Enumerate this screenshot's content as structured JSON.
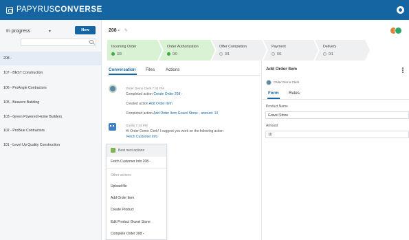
{
  "app": {
    "brand_light": "PAPYRUS",
    "brand_bold": "CONVERSE"
  },
  "sidebar": {
    "filter": "In progress",
    "new_button": "New",
    "search_placeholder": "",
    "items": [
      {
        "label": "208 -",
        "active": true
      },
      {
        "label": "107 - BEST Construction"
      },
      {
        "label": "106 - ProAngle Contractors"
      },
      {
        "label": "105 - Beavers Building"
      },
      {
        "label": "103 - Green Powered Home Builders"
      },
      {
        "label": "102 - ProBlue Contractors"
      },
      {
        "label": "101 - Level Up Quality Construction"
      }
    ]
  },
  "header": {
    "title": "208 -"
  },
  "steps": [
    {
      "label": "Incoming Order",
      "count": "3/3",
      "status": "done"
    },
    {
      "label": "Order Authorization",
      "count": "0/0",
      "status": "done"
    },
    {
      "label": "Offer Completion",
      "count": "0/1",
      "status": "todo"
    },
    {
      "label": "Payment",
      "count": "0/1",
      "status": "todo"
    },
    {
      "label": "Delivery",
      "count": "0/1",
      "status": "todo"
    }
  ],
  "tabs": [
    "Conversation",
    "Files",
    "Actions"
  ],
  "conversation": {
    "msg1": {
      "meta": "Order Demo Clerk  7:42 PM",
      "line1_prefix": "Completed action ",
      "line1_link": "Create Order 208 -",
      "line2_prefix": "Created action ",
      "line2_link": "Add Order Item",
      "line3_prefix": "Completed action ",
      "line3_link": "Add Order Item Gravel Stone - amount: 10"
    },
    "msg2": {
      "meta": "Gorillo  7:43 PM",
      "text": "Hi Order Demo Clerk! I suggest you work on the following action",
      "link": "Fetch Customer Info"
    }
  },
  "action_menu": {
    "header": "Best next actions",
    "best": "Fetch Customer Info 208 -",
    "other_label": "Other actions",
    "items": [
      "Upload file",
      "Add Order Item",
      "Create Product",
      "Edit Product Gravel Stone",
      "Complete Order 208 -"
    ]
  },
  "right_panel": {
    "title": "Add Order Item",
    "owner": "Order Demo Clerk",
    "tabs": [
      "Form",
      "Rules"
    ],
    "fields": [
      {
        "label": "Product Name",
        "value": "Gravel Stone"
      },
      {
        "label": "Amount",
        "value": "10"
      }
    ]
  },
  "colors": {
    "primary": "#1565a3",
    "step_done": "#d9f2d3",
    "step_todo": "#eff0f1",
    "check_green": "#3cab3c"
  }
}
